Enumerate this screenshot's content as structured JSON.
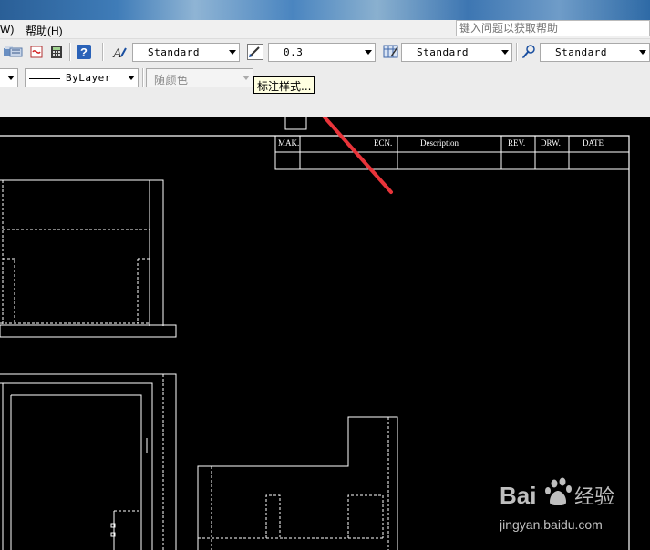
{
  "menubar": {
    "items": [
      "W)",
      "帮助(H)"
    ]
  },
  "help_search": {
    "placeholder": "键入问题以获取帮助"
  },
  "toolbar1": {
    "text_style": "Standard",
    "line_weight": "0.3",
    "table_style": "Standard",
    "multileader_style": "Standard"
  },
  "toolbar2": {
    "linetype": "ByLayer",
    "color": "随颜色"
  },
  "tooltip": {
    "text": "标注样式..."
  },
  "title_block": {
    "headers": [
      "MAK.",
      "ECN.",
      "Description",
      "REV.",
      "DRW.",
      "DATE"
    ]
  },
  "watermark": {
    "brand_left": "Bai",
    "brand_right": "经验",
    "url": "jingyan.baidu.com"
  },
  "colors": {
    "canvas": "#000000",
    "annotation_arrow": "#e8343a",
    "tooltip_bg": "#ffffe1"
  }
}
